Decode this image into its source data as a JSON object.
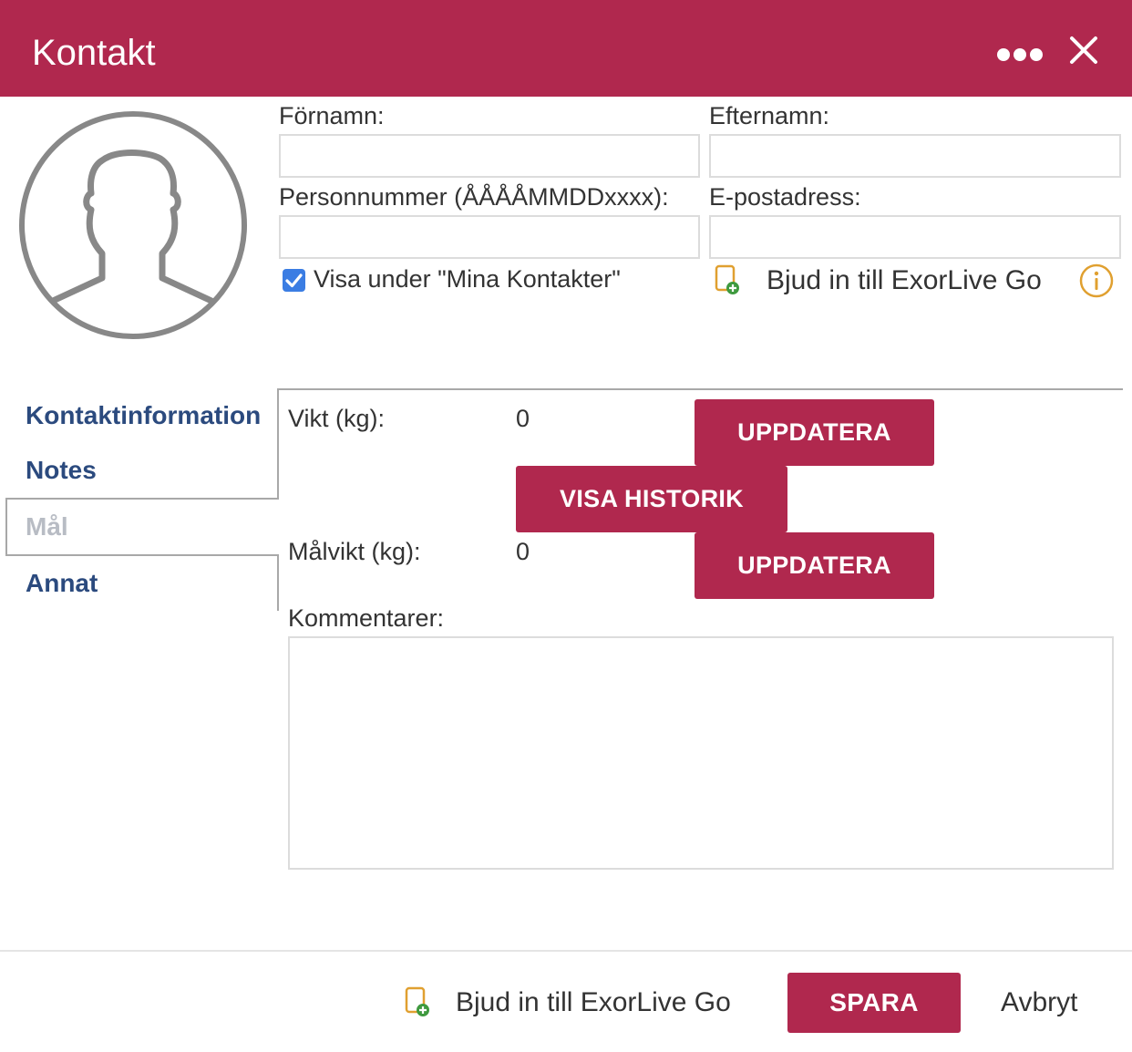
{
  "header": {
    "title": "Kontakt",
    "menu_icon": "more-dots-icon",
    "close_icon": "close-icon",
    "color": "#b0284e"
  },
  "avatar": {
    "icon": "user-avatar-icon"
  },
  "form": {
    "first_name": {
      "label": "Förnamn:",
      "value": ""
    },
    "last_name": {
      "label": "Efternamn:",
      "value": ""
    },
    "personal_number": {
      "label": "Personnummer (ÅÅÅÅMMDDxxxx):",
      "value": ""
    },
    "email": {
      "label": "E-postadress:",
      "value": ""
    },
    "show_in_contacts": {
      "label": "Visa under \"Mina Kontakter\"",
      "checked": true
    },
    "invite": {
      "label": "Bjud in till ExorLive Go",
      "icon": "invite-device-icon"
    },
    "info_icon": "info-icon"
  },
  "tabs": [
    {
      "label": "Kontaktinformation",
      "active": false
    },
    {
      "label": "Notes",
      "active": false
    },
    {
      "label": "Mål",
      "active": true
    },
    {
      "label": "Annat",
      "active": false
    }
  ],
  "goals": {
    "weight_label": "Vikt (kg):",
    "weight_value": "0",
    "update_label": "UPPDATERA",
    "history_label": "VISA HISTORIK",
    "target_weight_label": "Målvikt (kg):",
    "target_weight_value": "0",
    "update_target_label": "UPPDATERA",
    "comments_label": "Kommentarer:",
    "comments_value": ""
  },
  "footer": {
    "invite_label": "Bjud in till ExorLive Go",
    "save_label": "SPARA",
    "cancel_label": "Avbryt"
  }
}
